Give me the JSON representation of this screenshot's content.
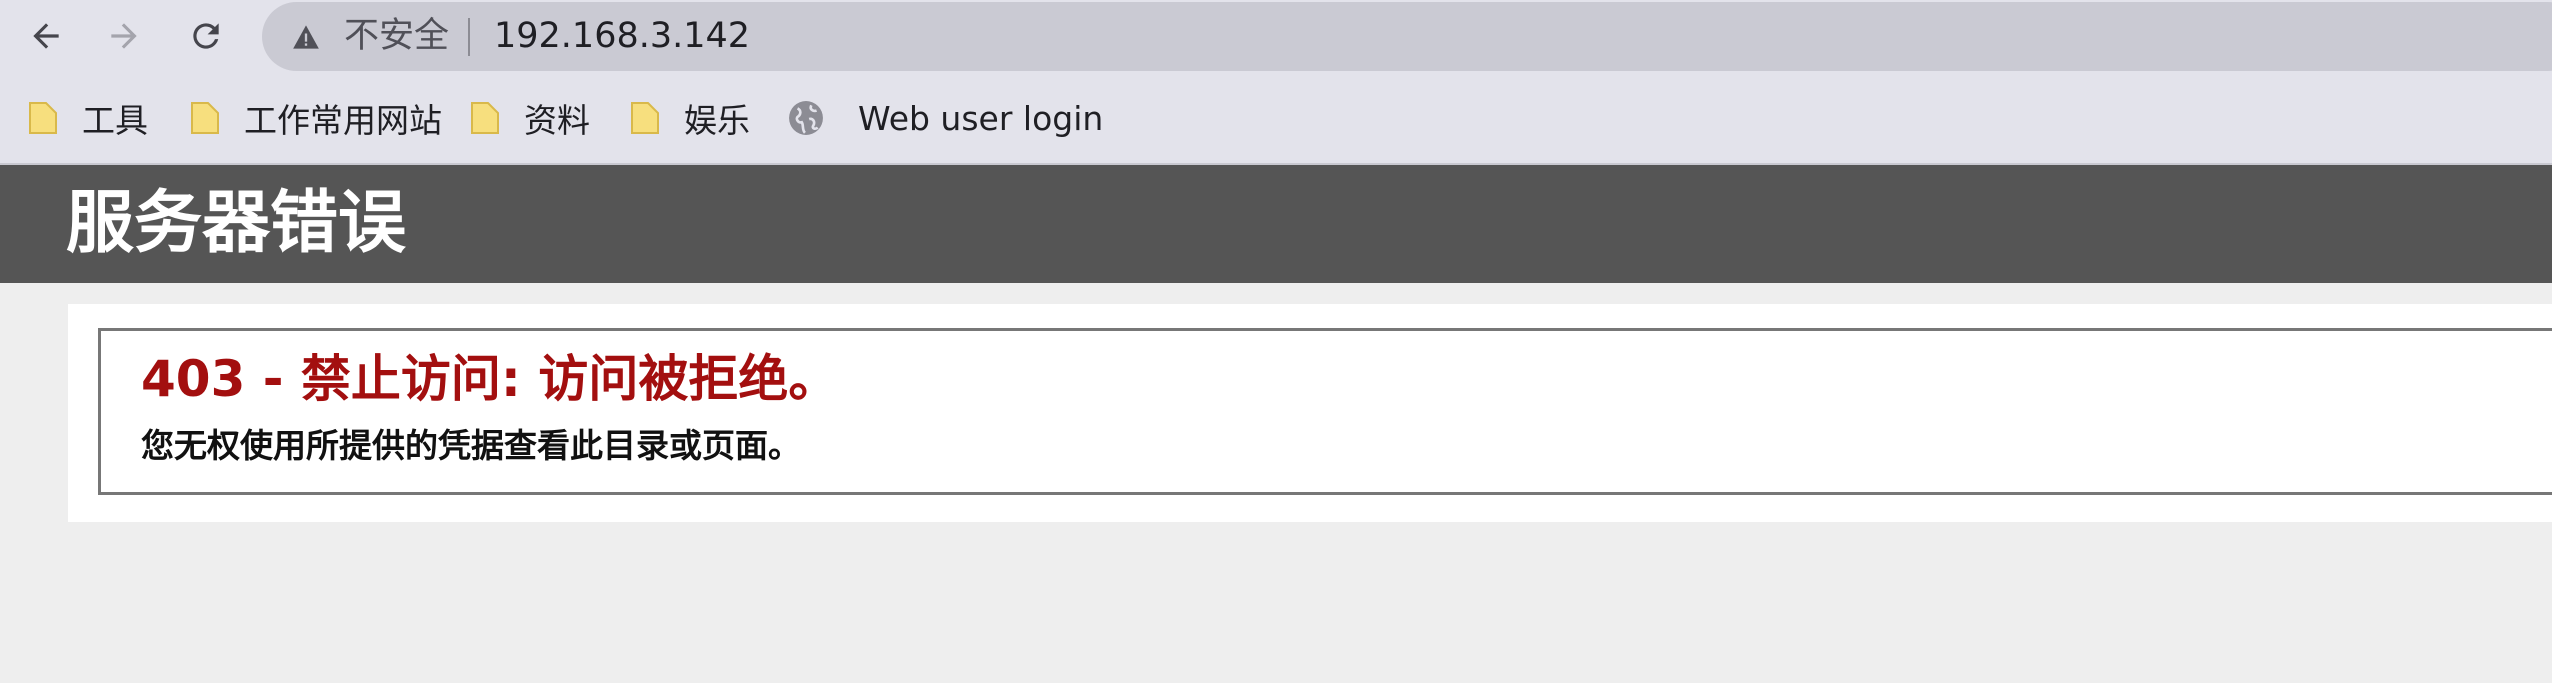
{
  "browser": {
    "nav": {
      "back_icon": "arrow-left-icon",
      "forward_icon": "arrow-right-icon",
      "reload_icon": "reload-icon"
    },
    "omnibox": {
      "security_icon": "warning-triangle-icon",
      "security_label": "不安全",
      "url": "192.168.3.142"
    },
    "bookmarks": [
      {
        "icon": "folder-icon",
        "label": "工具"
      },
      {
        "icon": "folder-icon",
        "label": "工作常用网站"
      },
      {
        "icon": "folder-icon",
        "label": "资料"
      },
      {
        "icon": "folder-icon",
        "label": "娱乐"
      },
      {
        "icon": "globe-icon",
        "label": "Web user login"
      }
    ]
  },
  "page": {
    "header_title": "服务器错误",
    "error_heading": "403 - 禁止访问: 访问被拒绝。",
    "error_message": "您无权使用所提供的凭据查看此目录或页面。"
  },
  "colors": {
    "header_bg": "#555555",
    "error_red": "#a30f0f",
    "page_bg": "#eeeeee",
    "chrome_bg": "#e3e3eb",
    "omnibox_bg": "#cacad3",
    "folder_yellow": "#f7df7e"
  }
}
